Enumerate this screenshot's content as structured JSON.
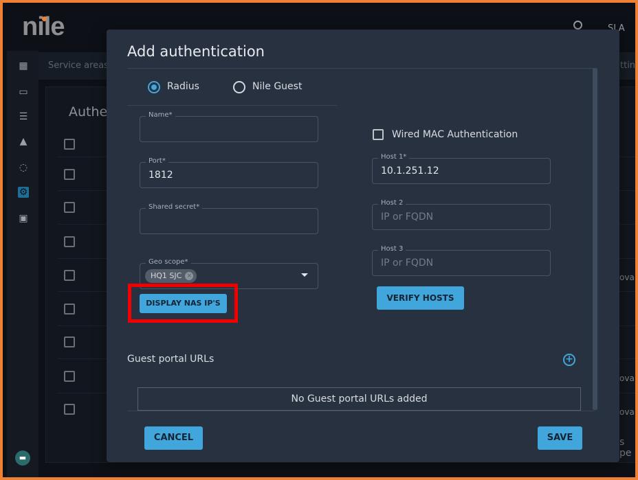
{
  "app": {
    "logo": "nile",
    "sla": "SLA",
    "subnav_left": "Service areas",
    "subnav_right": "ttin",
    "sidebar": [
      {
        "icon": "dashboard-icon"
      },
      {
        "icon": "devices-icon"
      },
      {
        "icon": "server-icon"
      },
      {
        "icon": "alert-icon"
      },
      {
        "icon": "refresh-icon"
      },
      {
        "icon": "settings-icon",
        "active": true
      },
      {
        "icon": "wallet-icon"
      }
    ],
    "background": {
      "title": "Authe",
      "row_fragments": [
        "ova",
        "ova",
        "ova",
        "s pe"
      ]
    }
  },
  "modal": {
    "title": "Add authentication",
    "radios": [
      {
        "label": "Radius",
        "selected": true
      },
      {
        "label": "Nile Guest",
        "selected": false
      }
    ],
    "fields": {
      "name": {
        "label": "Name*",
        "value": ""
      },
      "port": {
        "label": "Port*",
        "value": "1812"
      },
      "secret": {
        "label": "Shared secret*",
        "value": ""
      },
      "geo": {
        "label": "Geo scope*",
        "chip": "HQ1 SJC"
      },
      "host1": {
        "label": "Host 1*",
        "value": "10.1.251.12"
      },
      "host2": {
        "label": "Host 2",
        "placeholder": "IP or FQDN"
      },
      "host3": {
        "label": "Host 3",
        "placeholder": "IP or FQDN"
      }
    },
    "wired_mac": {
      "label": "Wired MAC Authentication",
      "checked": false
    },
    "display_nas_button": "DISPLAY NAS IP'S",
    "verify_hosts_button": "VERIFY HOSTS",
    "guest_portal": {
      "title": "Guest portal URLs",
      "empty": "No Guest portal URLs added"
    },
    "cancel": "CANCEL",
    "save": "SAVE"
  },
  "colors": {
    "accent": "#41a6dc",
    "modal_bg": "#283140",
    "highlight": "#f20000",
    "frame": "#ee8133"
  }
}
